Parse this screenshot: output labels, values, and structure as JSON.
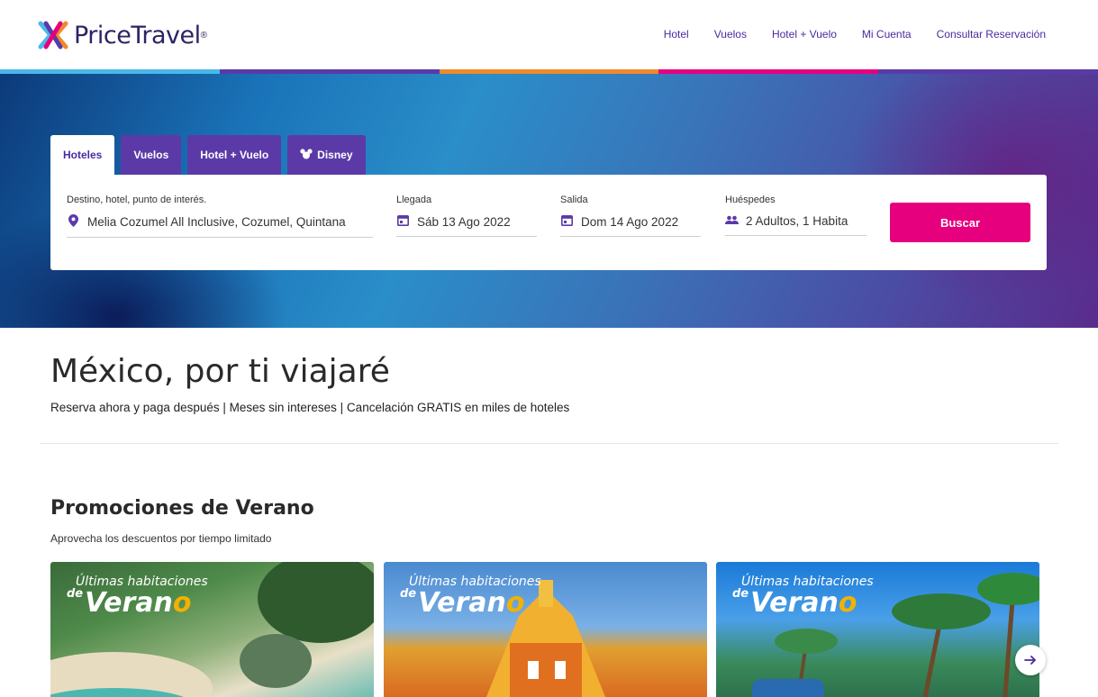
{
  "brand": {
    "name": "PriceTravel",
    "registered": "®"
  },
  "nav": [
    {
      "label": "Hotel"
    },
    {
      "label": "Vuelos"
    },
    {
      "label": "Hotel + Vuelo"
    },
    {
      "label": "Mi Cuenta"
    },
    {
      "label": "Consultar Reservación"
    }
  ],
  "colors": {
    "accent": "#4a2aa0",
    "tab": "#5b3aa8",
    "button": "#e6007e",
    "bar": [
      "#4ab8e8",
      "#5a3aa8",
      "#f08a2a",
      "#e6007e",
      "#5a3aa8"
    ]
  },
  "tabs": [
    {
      "label": "Hoteles",
      "active": true
    },
    {
      "label": "Vuelos"
    },
    {
      "label": "Hotel + Vuelo"
    },
    {
      "label": "Disney",
      "icon": "mickey-icon"
    }
  ],
  "search": {
    "destination": {
      "label": "Destino, hotel, punto de interés.",
      "value": "Melia Cozumel All Inclusive, Cozumel, Quintana",
      "icon": "location-pin-icon"
    },
    "checkin": {
      "label": "Llegada",
      "value": "Sáb 13 Ago 2022",
      "icon": "calendar-icon"
    },
    "checkout": {
      "label": "Salida",
      "value": "Dom 14 Ago 2022",
      "icon": "calendar-icon"
    },
    "guests": {
      "label": "Huéspedes",
      "value": "2 Adultos, 1 Habita",
      "icon": "people-icon"
    },
    "button": "Buscar"
  },
  "headline": "México, por ti viajaré",
  "subline": "Reserva ahora y paga después | Meses sin intereses | Cancelación GRATIS en miles de hoteles",
  "promos": {
    "title": "Promociones de Verano",
    "subtitle": "Aprovecha los descuentos por tiempo limitado",
    "cards": [
      {
        "line1": "Últimas habitaciones",
        "line2_prefix": "de",
        "line2_main": "Veran",
        "line2_o": "o"
      },
      {
        "line1": "Últimas habitaciones",
        "line2_prefix": "de",
        "line2_main": "Veran",
        "line2_o": "o"
      },
      {
        "line1": "Últimas habitaciones",
        "line2_prefix": "de",
        "line2_main": "Veran",
        "line2_o": "o"
      }
    ]
  }
}
